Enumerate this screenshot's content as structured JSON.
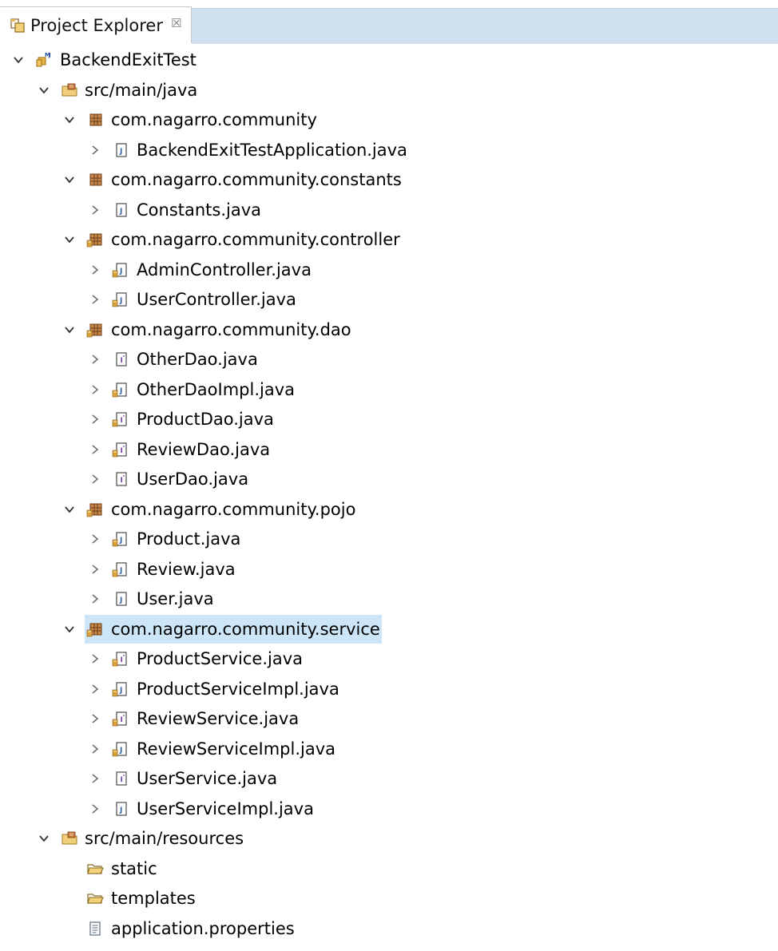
{
  "view": {
    "title": "Project Explorer",
    "close_glyph": "☒"
  },
  "tree": [
    {
      "label": "BackendExitTest",
      "depth": 0,
      "chevron": "down",
      "icon": "project-icon",
      "name": "project-backendexittest"
    },
    {
      "label": "src/main/java",
      "depth": 1,
      "chevron": "down",
      "icon": "source-folder-icon",
      "name": "source-folder-src-main-java"
    },
    {
      "label": "com.nagarro.community",
      "depth": 2,
      "chevron": "down",
      "icon": "package-icon",
      "name": "package-community"
    },
    {
      "label": "BackendExitTestApplication.java",
      "depth": 3,
      "chevron": "right",
      "icon": "java-file-icon",
      "name": "file-backendexittestapplication"
    },
    {
      "label": "com.nagarro.community.constants",
      "depth": 2,
      "chevron": "down",
      "icon": "package-icon",
      "name": "package-constants"
    },
    {
      "label": "Constants.java",
      "depth": 3,
      "chevron": "right",
      "icon": "java-file-icon",
      "name": "file-constants"
    },
    {
      "label": "com.nagarro.community.controller",
      "depth": 2,
      "chevron": "down",
      "icon": "package-modified-icon",
      "name": "package-controller"
    },
    {
      "label": "AdminController.java",
      "depth": 3,
      "chevron": "right",
      "icon": "java-file-modified-icon",
      "name": "file-admincontroller"
    },
    {
      "label": "UserController.java",
      "depth": 3,
      "chevron": "right",
      "icon": "java-file-modified-icon",
      "name": "file-usercontroller"
    },
    {
      "label": "com.nagarro.community.dao",
      "depth": 2,
      "chevron": "down",
      "icon": "package-modified-icon",
      "name": "package-dao"
    },
    {
      "label": "OtherDao.java",
      "depth": 3,
      "chevron": "right",
      "icon": "java-interface-icon",
      "name": "file-otherdao"
    },
    {
      "label": "OtherDaoImpl.java",
      "depth": 3,
      "chevron": "right",
      "icon": "java-file-modified-icon",
      "name": "file-otherdaoimpl"
    },
    {
      "label": "ProductDao.java",
      "depth": 3,
      "chevron": "right",
      "icon": "java-interface-modified-icon",
      "name": "file-productdao"
    },
    {
      "label": "ReviewDao.java",
      "depth": 3,
      "chevron": "right",
      "icon": "java-interface-modified-icon",
      "name": "file-reviewdao"
    },
    {
      "label": "UserDao.java",
      "depth": 3,
      "chevron": "right",
      "icon": "java-interface-icon",
      "name": "file-userdao"
    },
    {
      "label": "com.nagarro.community.pojo",
      "depth": 2,
      "chevron": "down",
      "icon": "package-modified-icon",
      "name": "package-pojo"
    },
    {
      "label": "Product.java",
      "depth": 3,
      "chevron": "right",
      "icon": "java-file-modified-icon",
      "name": "file-product"
    },
    {
      "label": "Review.java",
      "depth": 3,
      "chevron": "right",
      "icon": "java-file-modified-icon",
      "name": "file-review"
    },
    {
      "label": "User.java",
      "depth": 3,
      "chevron": "right",
      "icon": "java-file-icon",
      "name": "file-user"
    },
    {
      "label": "com.nagarro.community.service",
      "depth": 2,
      "chevron": "down",
      "icon": "package-modified-icon",
      "name": "package-service",
      "selected": true
    },
    {
      "label": "ProductService.java",
      "depth": 3,
      "chevron": "right",
      "icon": "java-interface-modified-icon",
      "name": "file-productservice"
    },
    {
      "label": "ProductServiceImpl.java",
      "depth": 3,
      "chevron": "right",
      "icon": "java-file-modified-icon",
      "name": "file-productserviceimpl"
    },
    {
      "label": "ReviewService.java",
      "depth": 3,
      "chevron": "right",
      "icon": "java-interface-modified-icon",
      "name": "file-reviewservice"
    },
    {
      "label": "ReviewServiceImpl.java",
      "depth": 3,
      "chevron": "right",
      "icon": "java-file-modified-icon",
      "name": "file-reviewserviceimpl"
    },
    {
      "label": "UserService.java",
      "depth": 3,
      "chevron": "right",
      "icon": "java-interface-icon",
      "name": "file-userservice"
    },
    {
      "label": "UserServiceImpl.java",
      "depth": 3,
      "chevron": "right",
      "icon": "java-file-icon",
      "name": "file-userserviceimpl"
    },
    {
      "label": "src/main/resources",
      "depth": 1,
      "chevron": "down",
      "icon": "source-folder-icon",
      "name": "source-folder-src-main-resources"
    },
    {
      "label": "static",
      "depth": 2,
      "chevron": "none",
      "icon": "folder-icon",
      "name": "folder-static"
    },
    {
      "label": "templates",
      "depth": 2,
      "chevron": "none",
      "icon": "folder-icon",
      "name": "folder-templates"
    },
    {
      "label": "application.properties",
      "depth": 2,
      "chevron": "none",
      "icon": "properties-file-icon",
      "name": "file-application-properties"
    }
  ]
}
